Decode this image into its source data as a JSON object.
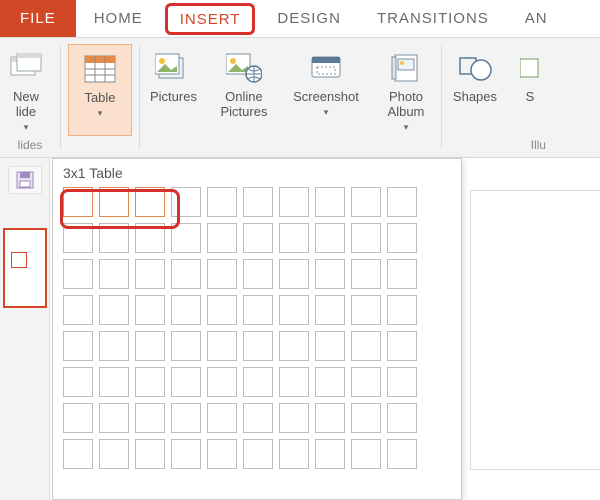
{
  "tabs": {
    "file": "FILE",
    "home": "HOME",
    "insert": "INSERT",
    "design": "DESIGN",
    "transitions": "TRANSITIONS",
    "animations_partial": "AN"
  },
  "ribbon": {
    "new_slide": "New",
    "new_slide2": "lide",
    "new_slide_caret": "▾",
    "slides_group": "lides",
    "table": "Table",
    "table_caret": "▾",
    "pictures": "Pictures",
    "online_pictures_l1": "Online",
    "online_pictures_l2": "Pictures",
    "screenshot": "Screenshot",
    "screenshot_caret": "▾",
    "photo_album_l1": "Photo",
    "photo_album_l2": "Album",
    "photo_album_caret": "▾",
    "shapes": "Shapes",
    "shapes_caret": "",
    "smartart_partial": "S",
    "illustrations_group": "Illu"
  },
  "dropdown": {
    "title": "3x1 Table",
    "cols": 10,
    "rows": 8,
    "selected_cols": 3,
    "selected_rows": 1
  }
}
